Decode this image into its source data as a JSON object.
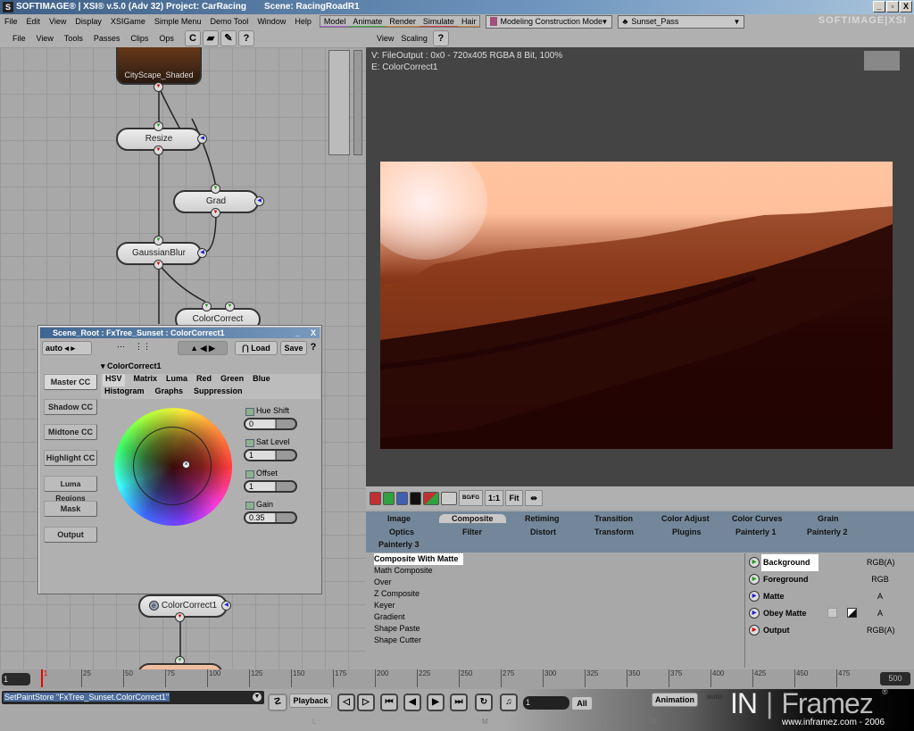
{
  "window": {
    "title": "SOFTIMAGE® | XSI® v.5.0 (Adv 32) Project: CarRacing",
    "scene": "Scene: RacingRoadR1",
    "brand": "SOFTIMAGE|XSI",
    "controls": [
      "_",
      "▫",
      "X"
    ]
  },
  "menubar": {
    "items": [
      "File",
      "Edit",
      "View",
      "Display",
      "XSIGame",
      "Simple Menu",
      "Demo Tool",
      "Window",
      "Help"
    ],
    "modes": [
      "Model",
      "Animate",
      "Render",
      "Simulate",
      "Hair"
    ],
    "construction_mode": "Modeling Construction Mode",
    "pass": "Sunset_Pass"
  },
  "fx_toolbar": {
    "menus": [
      "File",
      "View",
      "Tools",
      "Passes",
      "Clips",
      "Ops"
    ],
    "help": "?"
  },
  "viewer_toolbar": {
    "menus": [
      "View",
      "Scaling"
    ],
    "help": "?"
  },
  "fx_tree": {
    "nodes": [
      {
        "label": "CityScape_Shaded"
      },
      {
        "label": "Resize"
      },
      {
        "label": "Grad"
      },
      {
        "label": "GaussianBlur"
      },
      {
        "label": "ColorCorrect"
      },
      {
        "label": "ColorCorrect1"
      }
    ]
  },
  "viewer": {
    "info_line1": "V: FileOutput : 0x0 - 720x405 RGBA 8 Bit, 100%",
    "info_line2": "E: ColorCorrect1"
  },
  "viewer_tools": {
    "channels": [
      "red",
      "green",
      "blue",
      "alpha"
    ],
    "buttons": [
      "BG/FG",
      "1:1",
      "Fit"
    ]
  },
  "tool_tabs": {
    "row1": [
      "Image",
      "Composite",
      "Retiming",
      "Transition",
      "Color Adjust",
      "Color Curves",
      "Grain"
    ],
    "row2": [
      "Optics",
      "Filter",
      "Distort",
      "Transform",
      "Plugins",
      "Painterly 1",
      "Painterly 2"
    ],
    "row3": [
      "Painterly 3"
    ],
    "active": "Composite"
  },
  "tool_list": {
    "items": [
      "Composite With Matte",
      "Math Composite",
      "Over",
      "Z Composite",
      "Keyer",
      "Gradient",
      "Shape Paste",
      "Shape Cutter"
    ],
    "selected": "Composite With Matte"
  },
  "ports": [
    {
      "label": "Background",
      "type": "RGB(A)",
      "kind": "input"
    },
    {
      "label": "Foreground",
      "type": "RGB",
      "kind": "input"
    },
    {
      "label": "Matte",
      "type": "A",
      "kind": "matte"
    },
    {
      "label": "Obey Matte",
      "type": "A",
      "kind": "matte"
    },
    {
      "label": "Output",
      "type": "RGB(A)",
      "kind": "output"
    }
  ],
  "ppg": {
    "title": "Scene_Root : FxTree_Sunset : ColorCorrect1",
    "auto": "auto",
    "load": "Load",
    "save": "Save",
    "help": "?",
    "section": "ColorCorrect1",
    "side_buttons": [
      "Master CC",
      "Shadow CC",
      "Midtone CC",
      "Highlight CC",
      "Luma Regions",
      "Mask",
      "Output"
    ],
    "tabs_row1": [
      "HSV",
      "Matrix",
      "Luma",
      "Red",
      "Green",
      "Blue"
    ],
    "tabs_row2": [
      "Histogram",
      "Graphs",
      "Suppression"
    ],
    "active_tab": "HSV",
    "params": [
      {
        "label": "Hue Shift",
        "value": "0"
      },
      {
        "label": "Sat Level",
        "value": "1"
      },
      {
        "label": "Offset",
        "value": "1"
      },
      {
        "label": "Gain",
        "value": "0.35"
      }
    ]
  },
  "timeline": {
    "current_frame": "1",
    "ticks": [
      "1",
      "25",
      "50",
      "75",
      "100",
      "125",
      "150",
      "175",
      "200",
      "225",
      "250",
      "275",
      "300",
      "325",
      "350",
      "375",
      "400",
      "425",
      "450",
      "475"
    ],
    "end_frame": "500"
  },
  "command_bar": {
    "command": "SetPaintStore \"FxTree_Sunset.ColorCorrect1\"",
    "playback": "Playback",
    "frame_field": "1",
    "all": "All",
    "animation": "Animation",
    "auto": "auto",
    "markers": [
      "L",
      "M",
      "R"
    ]
  },
  "watermark": {
    "logo_left": "IN",
    "logo_right": "Framez",
    "url": "www.inframez.com - 2006"
  }
}
